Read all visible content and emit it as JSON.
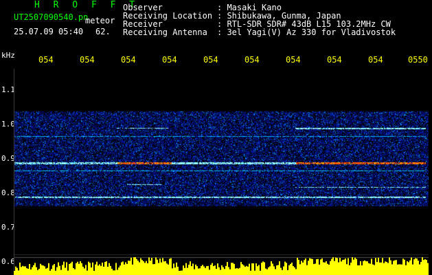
{
  "header": {
    "brand": "H R O F F T",
    "filename": "UT2507090540.pn",
    "tag": "meteor",
    "datetime": "25.07.09 05:40",
    "count": "62.",
    "info": [
      {
        "label": "Observer",
        "value": ": Masaki Kano"
      },
      {
        "label": "Receiving Location",
        "value": ": Shibukawa, Gunma, Japan"
      },
      {
        "label": "Receiver",
        "value": ": RTL-SDR SDR# 43dB L15 103.2MHz CW"
      },
      {
        "label": "Receiving Antenna",
        "value": ": 3el Yagi(V) Az 330 for Vladivostok"
      }
    ]
  },
  "axis": {
    "unit": "kHz",
    "x_ticks": [
      "054",
      "054",
      "054",
      "054",
      "054",
      "054",
      "054",
      "054",
      "054",
      "0550"
    ],
    "y_ticks": [
      "1.1",
      "1.0",
      "0.9",
      "0.8",
      "0.7",
      "0.6"
    ]
  },
  "colors": {
    "brand": "#00ff00",
    "ticks_x": "#ffff00",
    "echo_band": "#ff3300",
    "meter": "#ffff00",
    "spectrogram_bg": "#000030"
  }
}
